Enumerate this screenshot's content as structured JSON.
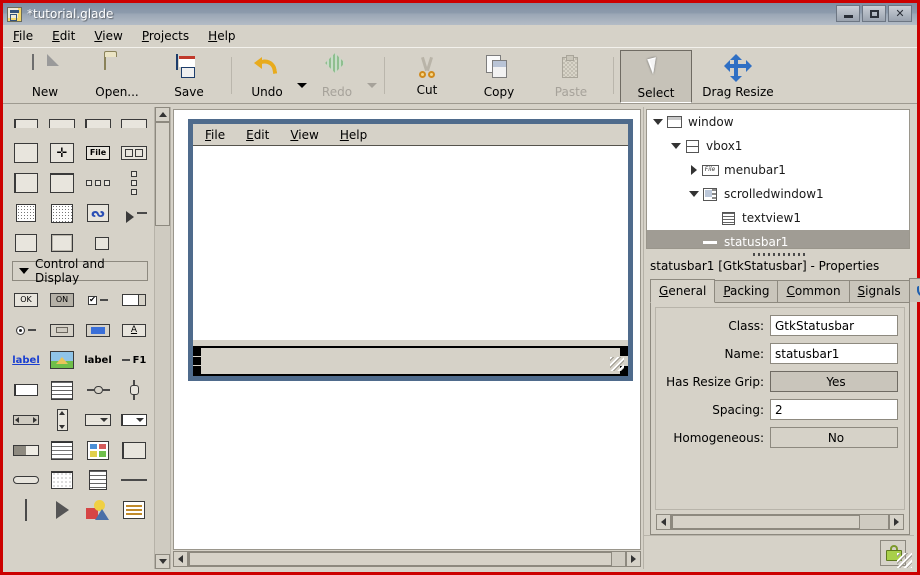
{
  "window": {
    "title": "*tutorial.glade",
    "icon": "glade-app-icon",
    "buttons": {
      "minimize": "–",
      "maximize": "□",
      "close": "✕"
    }
  },
  "menubar": [
    {
      "label": "File",
      "mnemonic": "F"
    },
    {
      "label": "Edit",
      "mnemonic": "E"
    },
    {
      "label": "View",
      "mnemonic": "V"
    },
    {
      "label": "Projects",
      "mnemonic": "P"
    },
    {
      "label": "Help",
      "mnemonic": "H"
    }
  ],
  "toolbar": [
    {
      "label": "New",
      "icon": "new-document-icon",
      "enabled": true,
      "active": false
    },
    {
      "label": "Open...",
      "icon": "open-folder-icon",
      "enabled": true,
      "active": false
    },
    {
      "label": "Save",
      "icon": "save-floppy-icon",
      "enabled": true,
      "active": false
    },
    {
      "label": "Undo",
      "icon": "undo-arrow-icon",
      "enabled": true,
      "active": false
    },
    {
      "label": "Redo",
      "icon": "redo-arrow-icon",
      "enabled": false,
      "active": false
    },
    {
      "label": "Cut",
      "icon": "scissors-icon",
      "enabled": true,
      "active": false
    },
    {
      "label": "Copy",
      "icon": "copy-icon",
      "enabled": true,
      "active": false
    },
    {
      "label": "Paste",
      "icon": "clipboard-icon",
      "enabled": false,
      "active": false
    },
    {
      "label": "Select",
      "icon": "mouse-cursor-icon",
      "enabled": true,
      "active": true
    },
    {
      "label": "Drag Resize",
      "icon": "move-arrows-icon",
      "enabled": true,
      "active": false
    }
  ],
  "palette": {
    "expander": {
      "label": "Control and Display",
      "expanded": true
    },
    "top_widgets": [
      "hbox-partial-icon",
      "hbox-wide-icon",
      "table-partial-icon",
      "frame-partial-icon",
      "alignment-icon",
      "fixed-icon",
      "menubar-widget-icon",
      "toolbar-icon",
      "hpaned-icon",
      "vpaned-icon",
      "hbuttonbox-icon",
      "vbuttonbox-icon",
      "scrolledwindow-icon",
      "viewport-icon",
      "eventbox-icon",
      "expander-icon",
      "handlebox-icon",
      "notebook-icon",
      "layout-icon"
    ],
    "control_widgets": [
      "button-ok-icon",
      "toggle-button-icon",
      "checkbutton-icon",
      "spinbutton-icon",
      "radiobutton-icon",
      "colorbutton-icon",
      "fontbutton-icon",
      "entry-a-icon",
      "linkbutton-icon",
      "image-icon",
      "label-icon",
      "accellabel-icon",
      "entry-icon",
      "textview-icon",
      "hseparator-handle-icon",
      "vscale-icon",
      "hscrollbar-icon",
      "vscrollbar-icon",
      "combobox-icon",
      "comboboxentry-icon",
      "progressbar-icon",
      "treeview-icon",
      "iconview-icon",
      "listbox-icon",
      "statusbar-icon",
      "calendar-icon",
      "textbuffer-icon",
      "hseparator-icon",
      "vseparator-icon",
      "arrow-icon",
      "drawingarea-icon",
      "listview-icon"
    ]
  },
  "canvas": {
    "design_window": {
      "menubar": [
        {
          "label": "File",
          "mnemonic": "F"
        },
        {
          "label": "Edit",
          "mnemonic": "E"
        },
        {
          "label": "View",
          "mnemonic": "V"
        },
        {
          "label": "Help",
          "mnemonic": "H"
        }
      ],
      "selected_widget": "statusbar1"
    }
  },
  "tree": {
    "nodes": [
      {
        "label": "window",
        "icon": "window-icon",
        "indent": 0,
        "expander": "open",
        "selected": false
      },
      {
        "label": "vbox1",
        "icon": "vbox-icon",
        "indent": 1,
        "expander": "open",
        "selected": false
      },
      {
        "label": "menubar1",
        "icon": "menubar-icon",
        "indent": 2,
        "expander": "closed",
        "selected": false
      },
      {
        "label": "scrolledwindow1",
        "icon": "scrolledwindow-icon",
        "indent": 2,
        "expander": "open",
        "selected": false
      },
      {
        "label": "textview1",
        "icon": "textview-icon",
        "indent": 3,
        "expander": "none",
        "selected": false
      },
      {
        "label": "statusbar1",
        "icon": "statusbar-icon",
        "indent": 2,
        "expander": "none",
        "selected": true
      }
    ]
  },
  "properties": {
    "title": "statusbar1 [GtkStatusbar] - Properties",
    "tabs": [
      {
        "label": "General",
        "mnemonic": "G",
        "active": true
      },
      {
        "label": "Packing",
        "mnemonic": "P",
        "active": false
      },
      {
        "label": "Common",
        "mnemonic": "C",
        "active": false
      },
      {
        "label": "Signals",
        "mnemonic": "S",
        "active": false
      }
    ],
    "accessibility_tab_icon": "accessibility-icon",
    "rows": [
      {
        "label": "Class:",
        "value": "GtkStatusbar",
        "kind": "text"
      },
      {
        "label": "Name:",
        "value": "statusbar1",
        "kind": "text"
      },
      {
        "label": "Has Resize Grip:",
        "value": "Yes",
        "kind": "toggle-on"
      },
      {
        "label": "Spacing:",
        "value": "2",
        "kind": "text"
      },
      {
        "label": "Homogeneous:",
        "value": "No",
        "kind": "toggle-off"
      }
    ],
    "lock_button_icon": "lock-icon"
  },
  "colors": {
    "window_border": "#cc0000",
    "chrome": "#d6d2c8",
    "selection": "#a09c94",
    "design_border": "#4f6b8c",
    "accent_blue": "#2f6fc4"
  }
}
